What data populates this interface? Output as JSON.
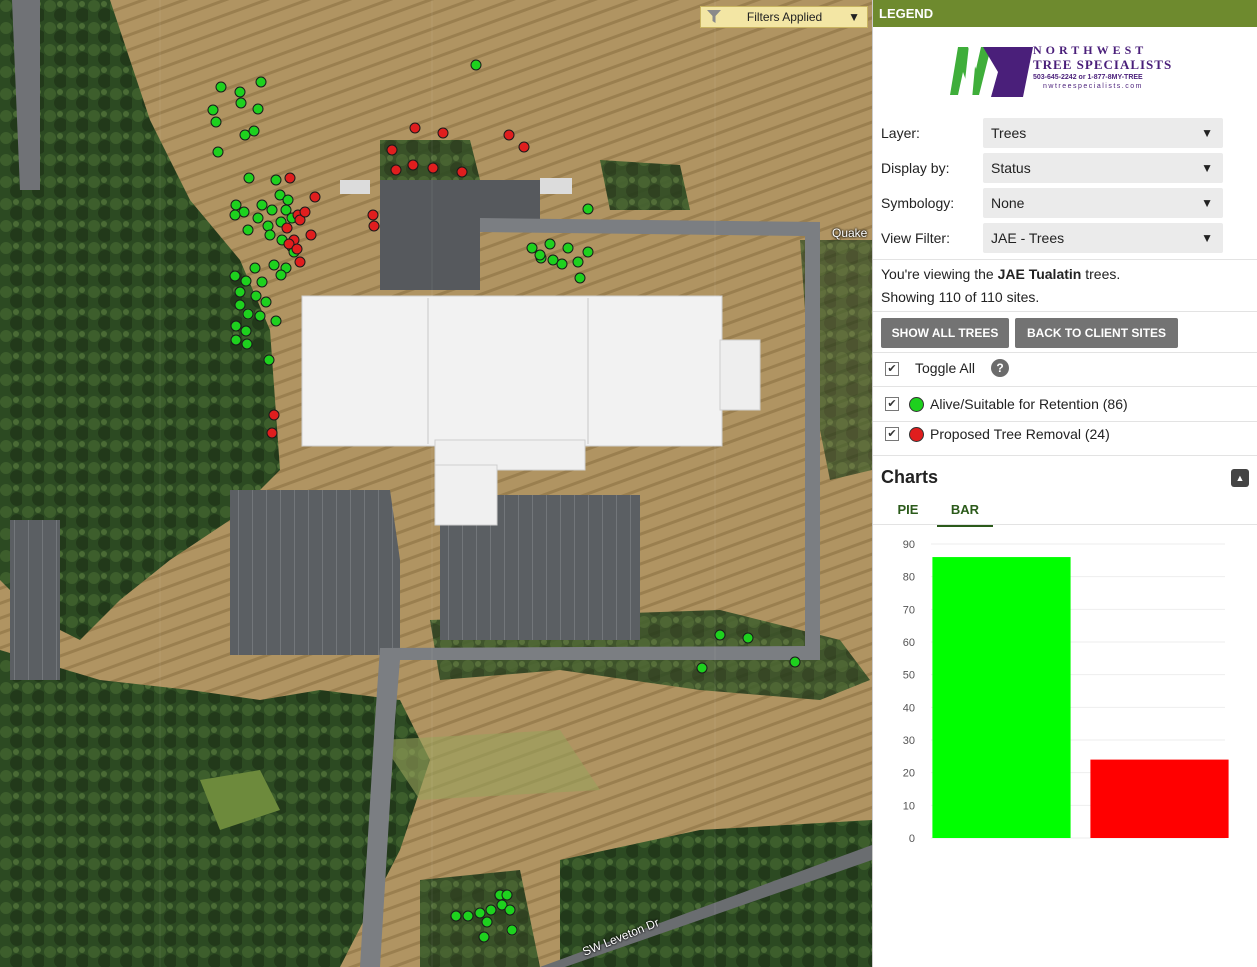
{
  "map": {
    "filters_label": "Filters Applied",
    "filter_icon": "funnel-icon",
    "street_labels": [
      "Quake",
      "SW Leveton Dr"
    ],
    "marker_colors": {
      "alive": "#1ed11e",
      "removal": "#e01e1e"
    }
  },
  "legend": {
    "header": "LEGEND",
    "logo": {
      "line1": "NORTHWEST",
      "line2": "TREE SPECIALISTS",
      "line3": "503-645-2242 or 1-877-8MY-TREE",
      "line4": "nwtreespecialists.com"
    },
    "controls": [
      {
        "label": "Layer:",
        "value": "Trees"
      },
      {
        "label": "Display by:",
        "value": "Status"
      },
      {
        "label": "Symbology:",
        "value": "None"
      },
      {
        "label": "View Filter:",
        "value": "JAE - Trees"
      }
    ],
    "info": {
      "prefix": "You're viewing the ",
      "site": "JAE Tualatin",
      "suffix": " trees.",
      "count_text": "Showing 110 of 110 sites."
    },
    "buttons": {
      "show_all": "SHOW ALL TREES",
      "back": "BACK TO CLIENT SITES"
    },
    "toggle_all": "Toggle All",
    "categories": [
      {
        "label": "Alive/Suitable for Retention (86)",
        "color": "#1ed11e",
        "checked": true
      },
      {
        "label": "Proposed Tree Removal (24)",
        "color": "#e01e1e",
        "checked": true
      }
    ]
  },
  "charts": {
    "title": "Charts",
    "tabs": [
      {
        "label": "PIE",
        "active": false
      },
      {
        "label": "BAR",
        "active": true
      }
    ]
  },
  "chart_data": {
    "type": "bar",
    "categories": [
      "Alive/Suitable for Retention",
      "Proposed Tree Removal"
    ],
    "values": [
      86,
      24
    ],
    "colors": [
      "#00ff00",
      "#ff0000"
    ],
    "ylim": [
      0,
      90
    ],
    "yticks": [
      0,
      10,
      20,
      30,
      40,
      50,
      60,
      70,
      80,
      90
    ],
    "title": "",
    "xlabel": "",
    "ylabel": "",
    "grid": true
  }
}
